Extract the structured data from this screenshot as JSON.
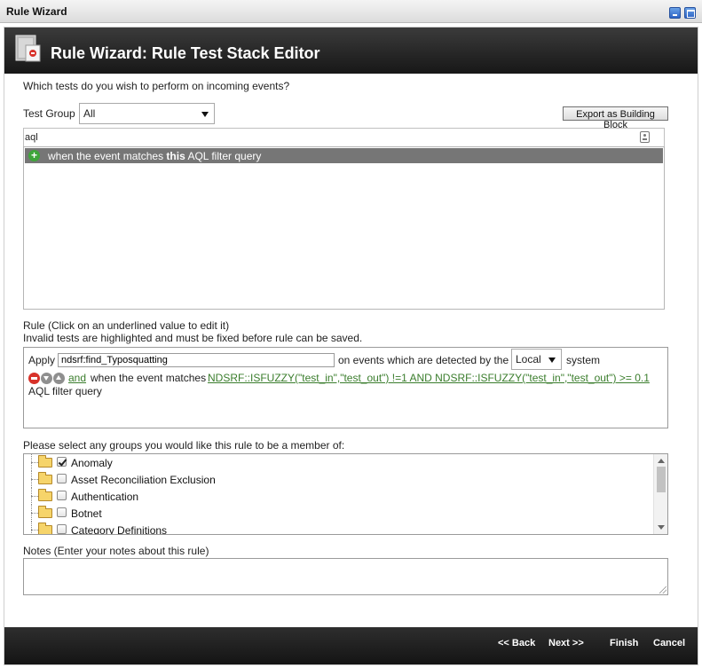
{
  "window": {
    "title": "Rule Wizard"
  },
  "header": {
    "title": "Rule Wizard: Rule Test Stack Editor",
    "icon": "rule-wizard-icon"
  },
  "question": "Which tests do you wish to perform on incoming events?",
  "test_group": {
    "label": "Test Group",
    "selected": "All"
  },
  "export_button": "Export as Building Block",
  "search": {
    "value": "aql"
  },
  "test_list": [
    {
      "prefix": "when the event matches ",
      "bold": "this",
      "suffix": " AQL filter query"
    }
  ],
  "rule_section": {
    "heading": "Rule (Click on an underlined value to edit it)",
    "note": "Invalid tests are highlighted and must be fixed before rule can be saved.",
    "apply_label": "Apply",
    "rule_name": "ndsrf:find_Typosquatting",
    "detected_label": "on events which are detected by the",
    "system_value": "Local",
    "system_label": "system",
    "condition": {
      "and_text": "and",
      "prefix": "when the event matches",
      "query": "NDSRF::ISFUZZY(\"test_in\",\"test_out\") !=1 AND NDSRF::ISFUZZY(\"test_in\",\"test_out\") >= 0.1",
      "suffix": "AQL filter query"
    }
  },
  "groups_section": {
    "heading": "Please select any groups you would like this rule to be a member of:",
    "groups": [
      {
        "label": "Anomaly",
        "checked": true
      },
      {
        "label": "Asset Reconciliation Exclusion",
        "checked": false
      },
      {
        "label": "Authentication",
        "checked": false
      },
      {
        "label": "Botnet",
        "checked": false
      },
      {
        "label": "Category Definitions",
        "checked": false
      }
    ]
  },
  "notes_section": {
    "heading": "Notes (Enter your notes about this rule)",
    "value": ""
  },
  "footer": {
    "back": "<< Back",
    "next": "Next >>",
    "finish": "Finish",
    "cancel": "Cancel"
  },
  "colors": {
    "header_bg": "#1f1f1f",
    "highlight_row": "#767676",
    "link_green": "#3a7d2c",
    "add_green": "#3ea53a",
    "remove_red": "#d8322a"
  }
}
